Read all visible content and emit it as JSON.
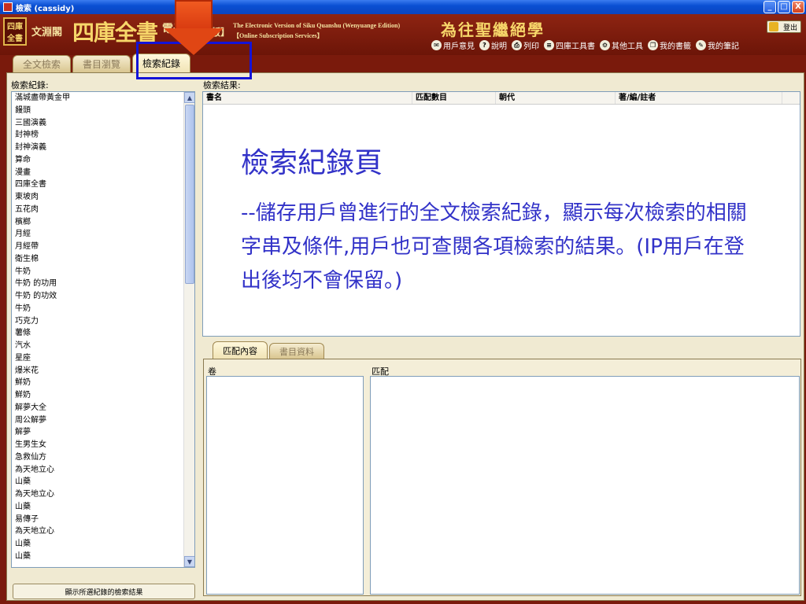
{
  "window": {
    "title": "檢索 (cassidy)",
    "minimize": "_",
    "maximize": "□",
    "close": "X"
  },
  "header": {
    "logo_text": "文淵閣四庫全書",
    "brand_small": "文淵閣",
    "brand_big": "四庫全書",
    "brand_sub": "電子",
    "brand_edition": "版】",
    "english_title": "The Electronic Version of Siku Quanshu (Wenyuange Edition)",
    "english_sub": "【Online Subscription Services】",
    "motto": "為往聖繼絕學",
    "logout_label": "登出",
    "toolbar": [
      {
        "label": "用戶意見",
        "icon": "feedback-icon"
      },
      {
        "label": "說明",
        "icon": "help-icon"
      },
      {
        "label": "列印",
        "icon": "print-icon"
      },
      {
        "label": "四庫工具書",
        "icon": "reference-icon"
      },
      {
        "label": "其他工具",
        "icon": "tools-icon"
      },
      {
        "label": "我的書籤",
        "icon": "bookmark-icon"
      },
      {
        "label": "我的筆記",
        "icon": "notes-icon"
      }
    ]
  },
  "tabs": [
    {
      "label": "全文檢索",
      "active": false
    },
    {
      "label": "書目瀏覽",
      "active": false
    },
    {
      "label": "檢索紀錄",
      "active": true
    }
  ],
  "history": {
    "label": "檢索紀錄:",
    "items": [
      "滿城盡帶黃金甲",
      "饅頭",
      "三國演義",
      "封神榜",
      "封神演義",
      "算命",
      "漫畫",
      "四庫全書",
      "東坡肉",
      "五花肉",
      "檳榔",
      "月經",
      "月經帶",
      "衛生棉",
      "牛奶",
      "牛奶 的功用",
      "牛奶 的功效",
      "牛奶",
      "巧克力",
      "薯條",
      "汽水",
      "星座",
      "爆米花",
      "鮮奶",
      "鮮奶",
      "解夢大全",
      "周公解夢",
      "解夢",
      "生男生女",
      "急救仙方",
      "為天地立心",
      "山藥",
      "為天地立心",
      "山藥",
      "易傳子",
      "為天地立心",
      "山藥",
      "山藥"
    ],
    "show_button": "顯示所選紀錄的檢索結果"
  },
  "results": {
    "label": "檢索結果:",
    "columns": [
      "書名",
      "匹配數目",
      "朝代",
      "著/編/註者"
    ]
  },
  "overlay": {
    "title": "檢索紀錄頁",
    "description": "--儲存用戶曾進行的全文檢索紀錄，顯示每次檢索的相關字串及條件,用戶也可查閱各項檢索的結果。(IP用戶在登出後均不會保留。)"
  },
  "subtabs": [
    {
      "label": "匹配內容",
      "active": true
    },
    {
      "label": "書目資料",
      "active": false
    }
  ],
  "match": {
    "juan_label": "卷",
    "match_label": "匹配"
  },
  "colors": {
    "brand_red": "#7a1a0c",
    "annotation_blue": "#3232c8",
    "arrow_orange": "#e04614"
  }
}
